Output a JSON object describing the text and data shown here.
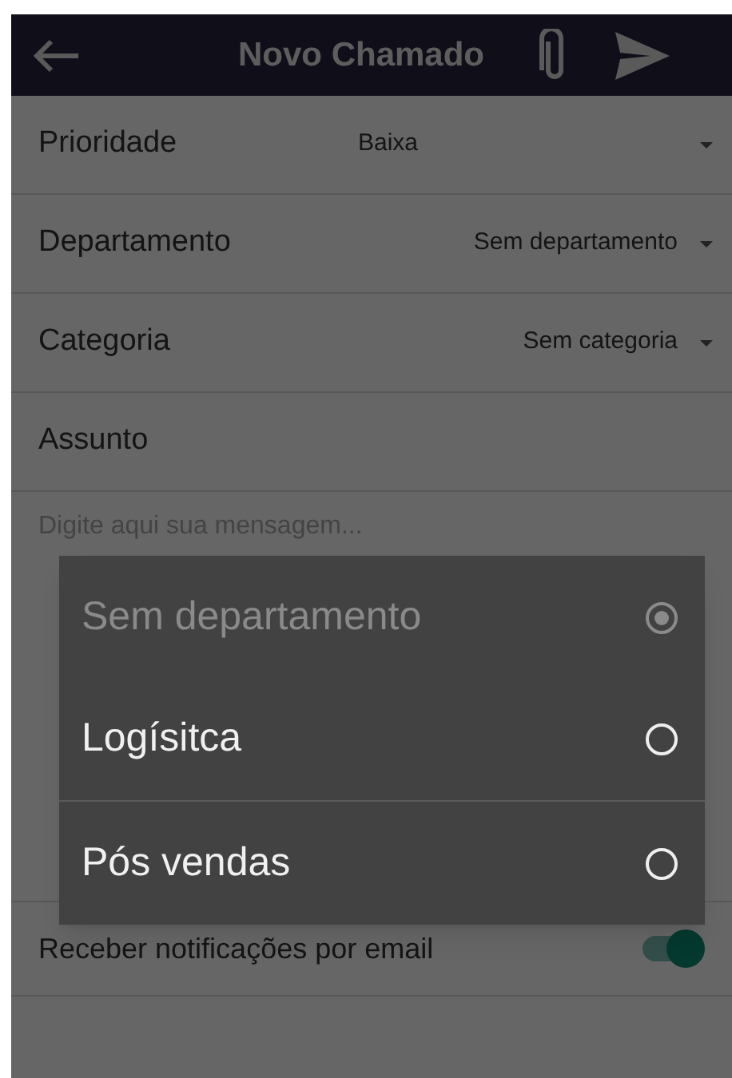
{
  "app_bar": {
    "title": "Novo Chamado"
  },
  "fields": [
    {
      "label": "Prioridade",
      "value": "Baixa"
    },
    {
      "label": "Departamento",
      "value": "Sem departamento"
    },
    {
      "label": "Categoria",
      "value": "Sem categoria"
    }
  ],
  "subject": {
    "placeholder": "Assunto"
  },
  "message": {
    "placeholder": "Digite aqui sua mensagem..."
  },
  "email_notifications": {
    "label": "Receber notificações por email",
    "on": true
  },
  "dialog": {
    "options": [
      {
        "label": "Sem departamento",
        "selected": true,
        "disabled": true
      },
      {
        "label": "Logísitca",
        "selected": false,
        "disabled": false
      },
      {
        "label": "Pós vendas",
        "selected": false,
        "disabled": false
      }
    ]
  }
}
